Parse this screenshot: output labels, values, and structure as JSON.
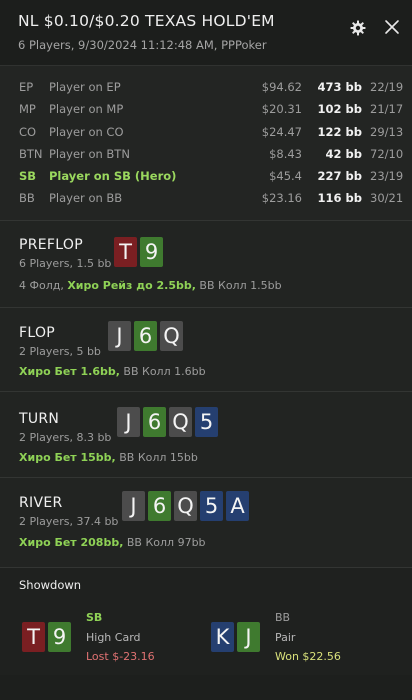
{
  "header": {
    "title": "NL $0.10/$0.20 TEXAS HOLD'EM",
    "subtitle": "6 Players, 9/30/2024 11:12:48 AM, PPPoker",
    "settings_icon": "gear-icon",
    "close_icon": "close-icon"
  },
  "players": [
    {
      "pos": "EP",
      "name": "Player on EP",
      "usd": "$94.62",
      "bb": "473 bb",
      "stat": "22/19"
    },
    {
      "pos": "MP",
      "name": "Player on MP",
      "usd": "$20.31",
      "bb": "102 bb",
      "stat": "21/17"
    },
    {
      "pos": "CO",
      "name": "Player on CO",
      "usd": "$24.47",
      "bb": "122 bb",
      "stat": "29/13"
    },
    {
      "pos": "BTN",
      "name": "Player on BTN",
      "usd": "$8.43",
      "bb": "42 bb",
      "stat": "72/10"
    },
    {
      "pos": "SB",
      "name": "Player on SB (Hero)",
      "usd": "$45.4",
      "bb": "227 bb",
      "stat": "23/19"
    },
    {
      "pos": "BB",
      "name": "Player on BB",
      "usd": "$23.16",
      "bb": "116 bb",
      "stat": "30/21"
    }
  ],
  "streets": {
    "preflop": {
      "name": "PREFLOP",
      "sub": "6 Players, 1.5 bb",
      "cards": [
        {
          "rank": "T",
          "suit": "hearts"
        },
        {
          "rank": "9",
          "suit": "clubs"
        }
      ],
      "prefix": "4 Фолд,",
      "hero_action": "Хиро Рейз до 2.5bb,",
      "rest": "BB Колл 1.5bb"
    },
    "flop": {
      "name": "FLOP",
      "sub": "2 Players, 5 bb",
      "cards": [
        {
          "rank": "J",
          "suit": "spades"
        },
        {
          "rank": "6",
          "suit": "clubs"
        },
        {
          "rank": "Q",
          "suit": "spades"
        }
      ],
      "hero_action": "Хиро Бет 1.6bb,",
      "rest": "BB Колл 1.6bb"
    },
    "turn": {
      "name": "TURN",
      "sub": "2 Players, 8.3 bb",
      "cards": [
        {
          "rank": "J",
          "suit": "spades"
        },
        {
          "rank": "6",
          "suit": "clubs"
        },
        {
          "rank": "Q",
          "suit": "spades"
        },
        {
          "rank": "5",
          "suit": "diamonds"
        }
      ],
      "hero_action": "Хиро Бет 15bb,",
      "rest": "BB Колл 15bb"
    },
    "river": {
      "name": "RIVER",
      "sub": "2 Players, 37.4 bb",
      "cards": [
        {
          "rank": "J",
          "suit": "spades"
        },
        {
          "rank": "6",
          "suit": "clubs"
        },
        {
          "rank": "Q",
          "suit": "spades"
        },
        {
          "rank": "5",
          "suit": "diamonds"
        },
        {
          "rank": "A",
          "suit": "diamonds"
        }
      ],
      "hero_action": "Хиро Бет 208bb,",
      "rest": "BB Колл 97bb"
    }
  },
  "showdown": {
    "title": "Showdown",
    "hero": {
      "pos": "SB",
      "hand": "High Card",
      "result": "Lost $-23.16",
      "cards": [
        {
          "rank": "T",
          "suit": "hearts"
        },
        {
          "rank": "9",
          "suit": "clubs"
        }
      ]
    },
    "villain": {
      "pos": "BB",
      "hand": "Pair",
      "result": "Won $22.56",
      "cards": [
        {
          "rank": "K",
          "suit": "diamonds"
        },
        {
          "rank": "J",
          "suit": "clubs"
        }
      ]
    }
  },
  "colors": {
    "hearts": "#7a1f22",
    "clubs": "#3f7a2f",
    "spades": "#4c4c4c",
    "diamonds": "#253f70",
    "hero_green": "#8fd256",
    "lost_red": "#e07272",
    "won_yellow": "#d8e07a"
  }
}
